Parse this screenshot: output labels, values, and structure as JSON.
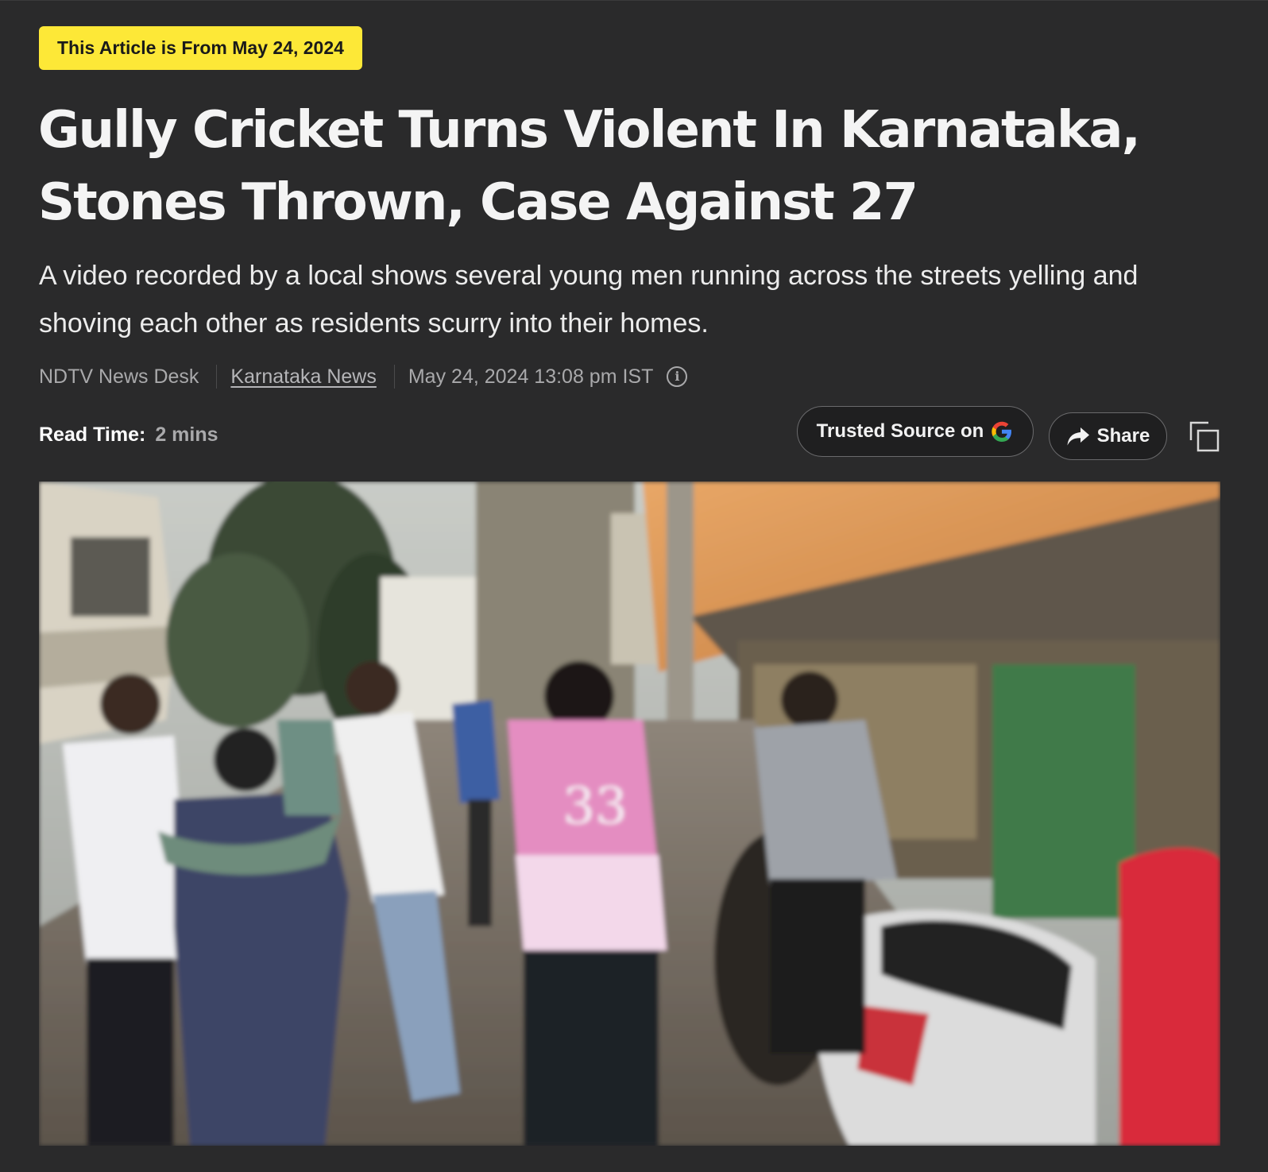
{
  "article": {
    "date_badge": "This Article is From May 24, 2024",
    "headline": "Gully Cricket Turns Violent In Karnataka, Stones Thrown, Case Against 27",
    "summary": "A video recorded by a local shows several young men running across the streets yelling and shoving each other as residents scurry into their homes.",
    "meta": {
      "author": "NDTV News Desk",
      "category": "Karnataka News",
      "published": "May 24, 2024 13:08 pm IST",
      "info_icon": "info-icon"
    },
    "read_time": {
      "label": "Read Time:",
      "value": "2 mins"
    }
  },
  "actions": {
    "trusted_source_label": "Trusted Source on",
    "trusted_source_icon": "google-g-icon",
    "share_label": "Share",
    "share_icon": "share-arrow-icon",
    "copy_icon": "copy-icon"
  },
  "photo": {
    "jersey_number": "33"
  },
  "colors": {
    "background": "#2a2a2b",
    "badge": "#fde837",
    "headline": "#f4f4f4",
    "meta_text": "#a9a9ab"
  }
}
